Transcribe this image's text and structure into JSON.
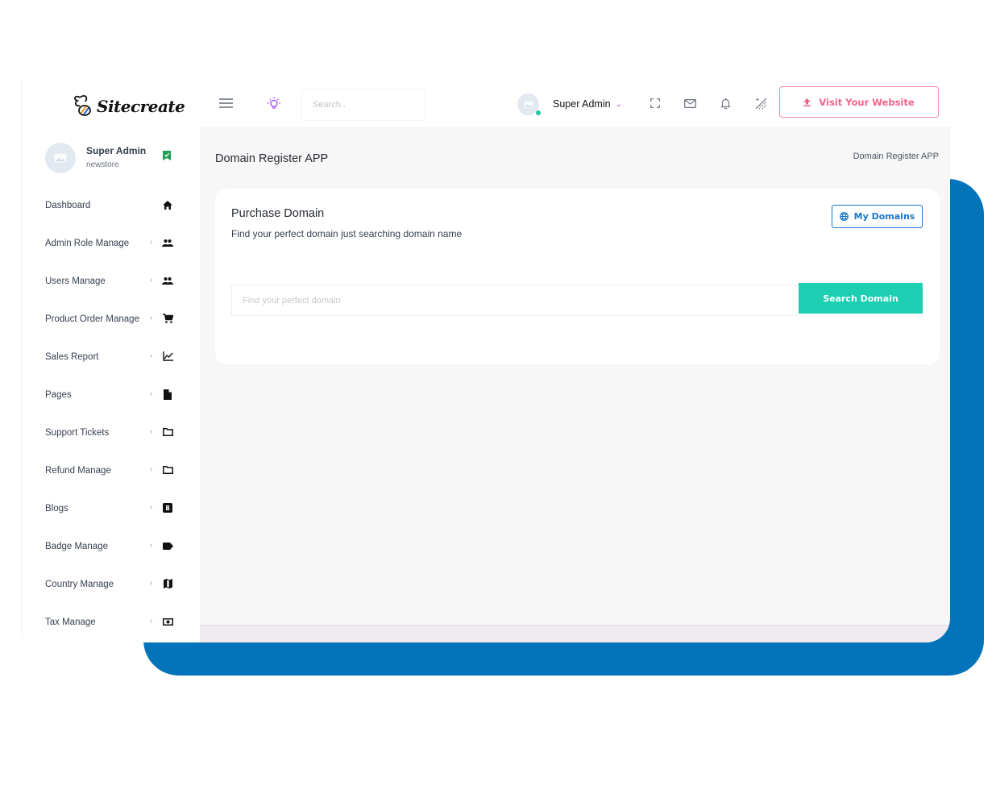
{
  "brand": {
    "name": "Sitecreate"
  },
  "profile": {
    "name": "Super Admin",
    "store": "newstore",
    "badge_icon": "verified-bookmark-icon",
    "badge_color": "#1f9d55"
  },
  "sidebar": {
    "items": [
      {
        "label": "Dashboard",
        "icon": "home-icon",
        "has_chevron": false
      },
      {
        "label": "Admin Role Manage",
        "icon": "people-icon",
        "has_chevron": true
      },
      {
        "label": "Users Manage",
        "icon": "people-icon",
        "has_chevron": true
      },
      {
        "label": "Product Order Manage",
        "icon": "cart-icon",
        "has_chevron": true
      },
      {
        "label": "Sales Report",
        "icon": "line-chart-icon",
        "has_chevron": true
      },
      {
        "label": "Pages",
        "icon": "file-icon",
        "has_chevron": true
      },
      {
        "label": "Support Tickets",
        "icon": "folder-icon",
        "has_chevron": true
      },
      {
        "label": "Refund Manage",
        "icon": "folder-icon",
        "has_chevron": true
      },
      {
        "label": "Blogs",
        "icon": "blogger-icon",
        "has_chevron": true
      },
      {
        "label": "Badge Manage",
        "icon": "label-icon",
        "has_chevron": true
      },
      {
        "label": "Country Manage",
        "icon": "map-icon",
        "has_chevron": true
      },
      {
        "label": "Tax Manage",
        "icon": "money-icon",
        "has_chevron": true
      }
    ],
    "chevron": "‹"
  },
  "header": {
    "search_placeholder": "Search..",
    "user_name": "Super Admin",
    "user_chevron": "⌄",
    "visit_label": "Visit Your Website",
    "accent_color": "#f0648a"
  },
  "main": {
    "page_title": "Domain Register APP",
    "breadcrumb": "Domain Register APP",
    "card": {
      "title": "Purchase Domain",
      "subtitle": "Find your perfect domain just searching domain name",
      "my_domains_label": "My Domains",
      "input_placeholder": "Find your perfect domain",
      "input_value": "",
      "search_label": "Search Domain",
      "search_color": "#1ccfb2"
    }
  },
  "colors": {
    "backdrop": "#0474ba",
    "link_blue": "#1976c8"
  }
}
